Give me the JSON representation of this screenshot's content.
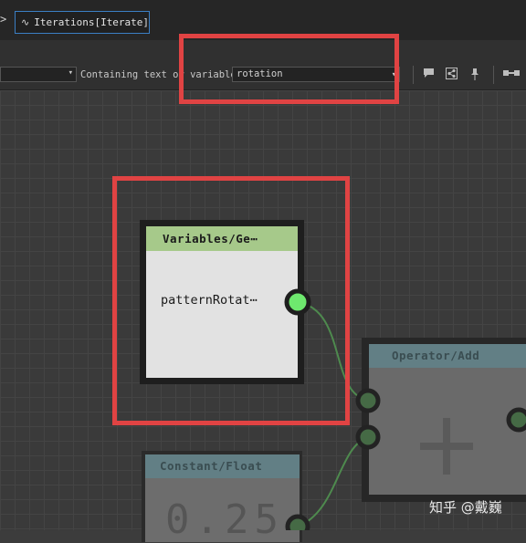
{
  "tab": {
    "chevron": ">",
    "icon": "∿",
    "label": "Iterations[Iterate]"
  },
  "filter": {
    "label": "Containing text or variable",
    "value": "rotation"
  },
  "toolbar_icons": [
    "comment-icon",
    "share-icon",
    "pin-icon",
    "link-icon"
  ],
  "nodes": {
    "variables": {
      "title": "Variables/Ge⋯",
      "output_label": "patternRotat⋯"
    },
    "operator": {
      "title": "Operator/Add",
      "symbol": "+"
    },
    "constant": {
      "title": "Constant/Float",
      "value": "0.25"
    }
  },
  "watermark": "知乎 @戴巍",
  "colors": {
    "highlight": "#e04343",
    "active_port": "#6ee86e",
    "variable_header": "#a6c98a",
    "operator_header": "#627f85"
  }
}
